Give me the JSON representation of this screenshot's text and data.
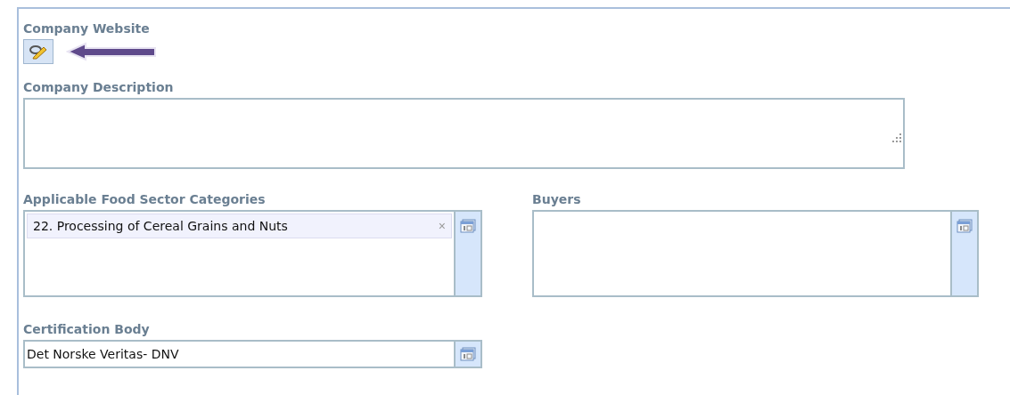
{
  "company_website": {
    "label": "Company Website"
  },
  "company_description": {
    "label": "Company Description"
  },
  "food_sector_categories": {
    "label": "Applicable Food Sector Categories",
    "items": [
      {
        "text": "22. Processing of Cereal Grains and Nuts",
        "remove": "×"
      }
    ]
  },
  "buyers": {
    "label": "Buyers"
  },
  "certification_body": {
    "label": "Certification Body",
    "value": "Det Norske Veritas- DNV"
  }
}
